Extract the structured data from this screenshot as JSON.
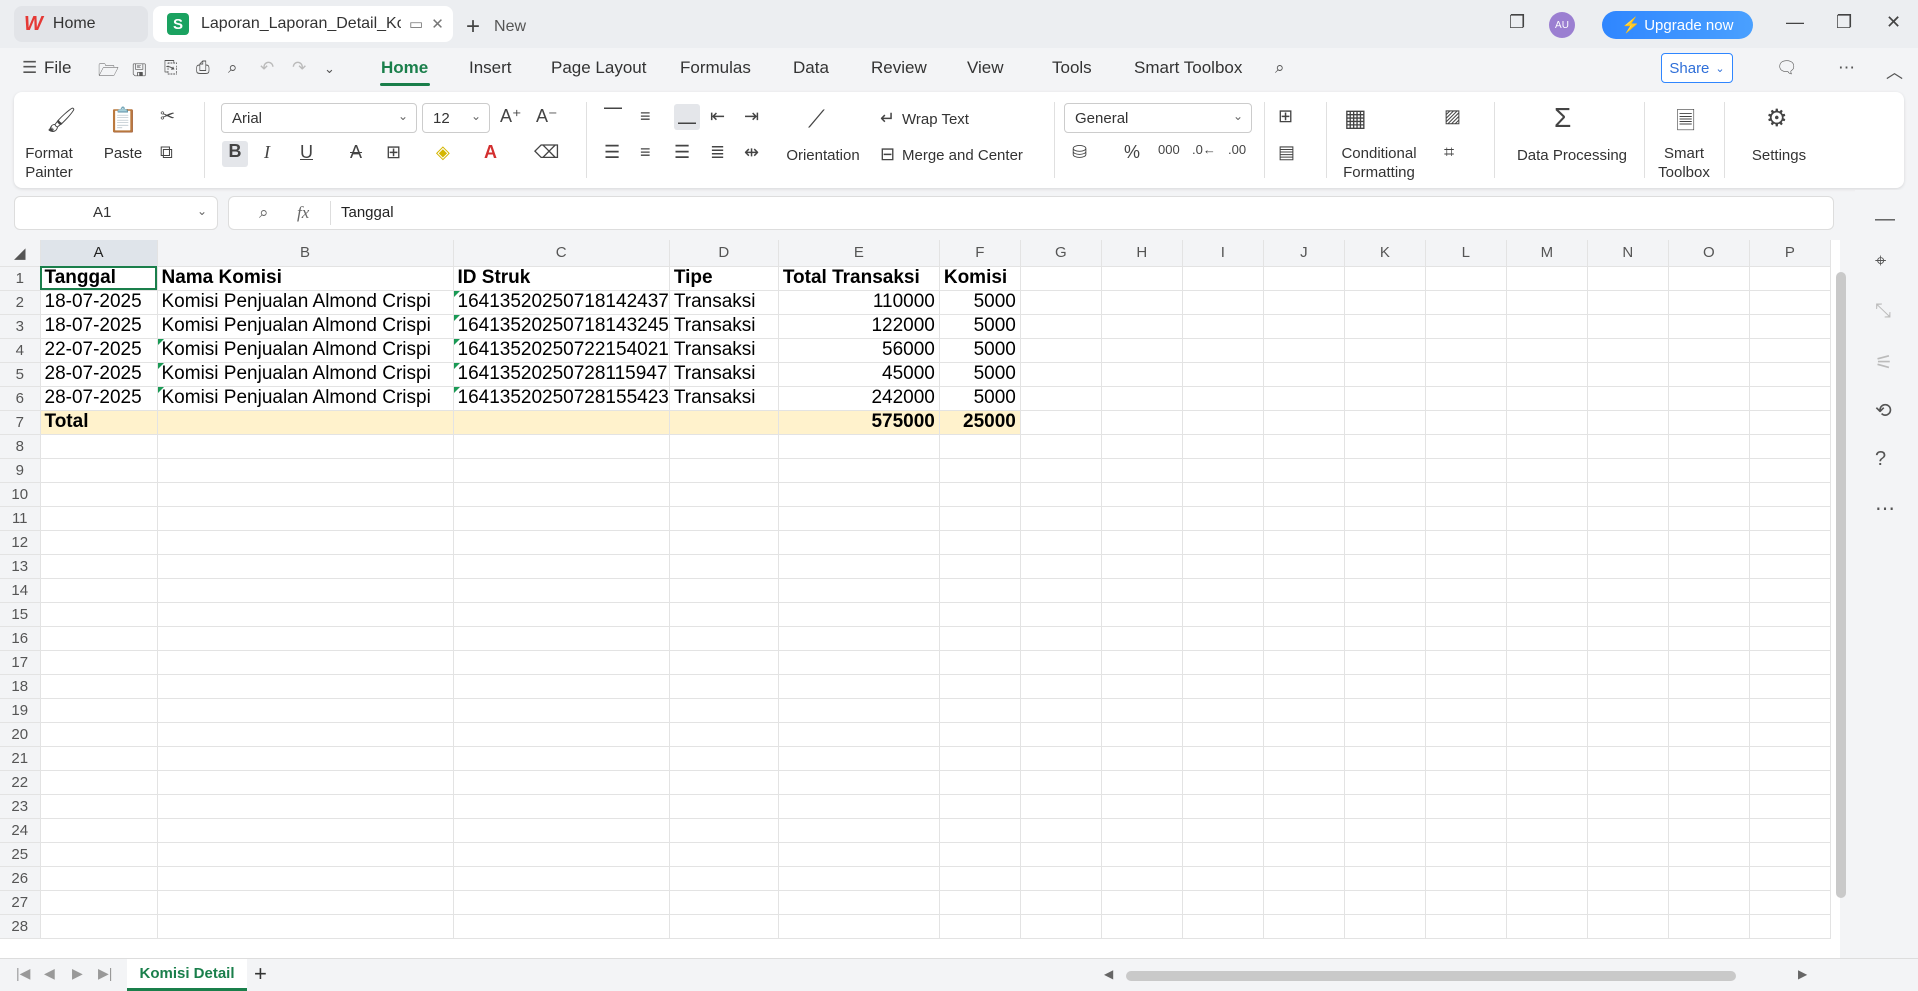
{
  "titlebar": {
    "tab_home": "Home",
    "tab_doc": "Laporan_Laporan_Detail_Komisi",
    "new_tab": "New",
    "avatar": "AU",
    "upgrade": "Upgrade now"
  },
  "menu": {
    "file": "File",
    "items": [
      "Home",
      "Insert",
      "Page Layout",
      "Formulas",
      "Data",
      "Review",
      "View",
      "Tools",
      "Smart Toolbox"
    ],
    "share": "Share"
  },
  "ribbon": {
    "format_painter": "Format Painter",
    "paste": "Paste",
    "font": "Arial",
    "size": "12",
    "wrap_text": "Wrap Text",
    "orientation": "Orientation",
    "merge_center": "Merge and Center",
    "number_format": "General",
    "conditional_formatting": "Conditional Formatting",
    "data_processing": "Data Processing",
    "smart_toolbox": "Smart Toolbox",
    "settings": "Settings"
  },
  "formula_bar": {
    "cell_ref": "A1",
    "fx": "fx",
    "content": "Tanggal"
  },
  "sheet": {
    "columns": [
      "A",
      "B",
      "C",
      "D",
      "E",
      "F",
      "G",
      "H",
      "I",
      "J",
      "K",
      "L",
      "M",
      "N",
      "O",
      "P"
    ],
    "headers": [
      "Tanggal",
      "Nama Komisi",
      "ID Struk",
      "Tipe",
      "Total Transaksi",
      "Komisi"
    ],
    "rows": [
      [
        "18-07-2025",
        "Komisi Penjualan Almond Crispi",
        "16413520250718142437",
        "Transaksi",
        "110000",
        "5000"
      ],
      [
        "18-07-2025",
        "Komisi Penjualan Almond Crispi",
        "16413520250718143245",
        "Transaksi",
        "122000",
        "5000"
      ],
      [
        "22-07-2025",
        "Komisi Penjualan Almond Crispi",
        "16413520250722154021",
        "Transaksi",
        "56000",
        "5000"
      ],
      [
        "28-07-2025",
        "Komisi Penjualan Almond Crispi",
        "16413520250728115947",
        "Transaksi",
        "45000",
        "5000"
      ],
      [
        "28-07-2025",
        "Komisi Penjualan Almond Crispi",
        "16413520250728155423",
        "Transaksi",
        "242000",
        "5000"
      ]
    ],
    "total_label": "Total",
    "total_transaksi": "575000",
    "total_komisi": "25000",
    "row_count": 28
  },
  "status": {
    "sheet_tab": "Komisi Detail"
  }
}
